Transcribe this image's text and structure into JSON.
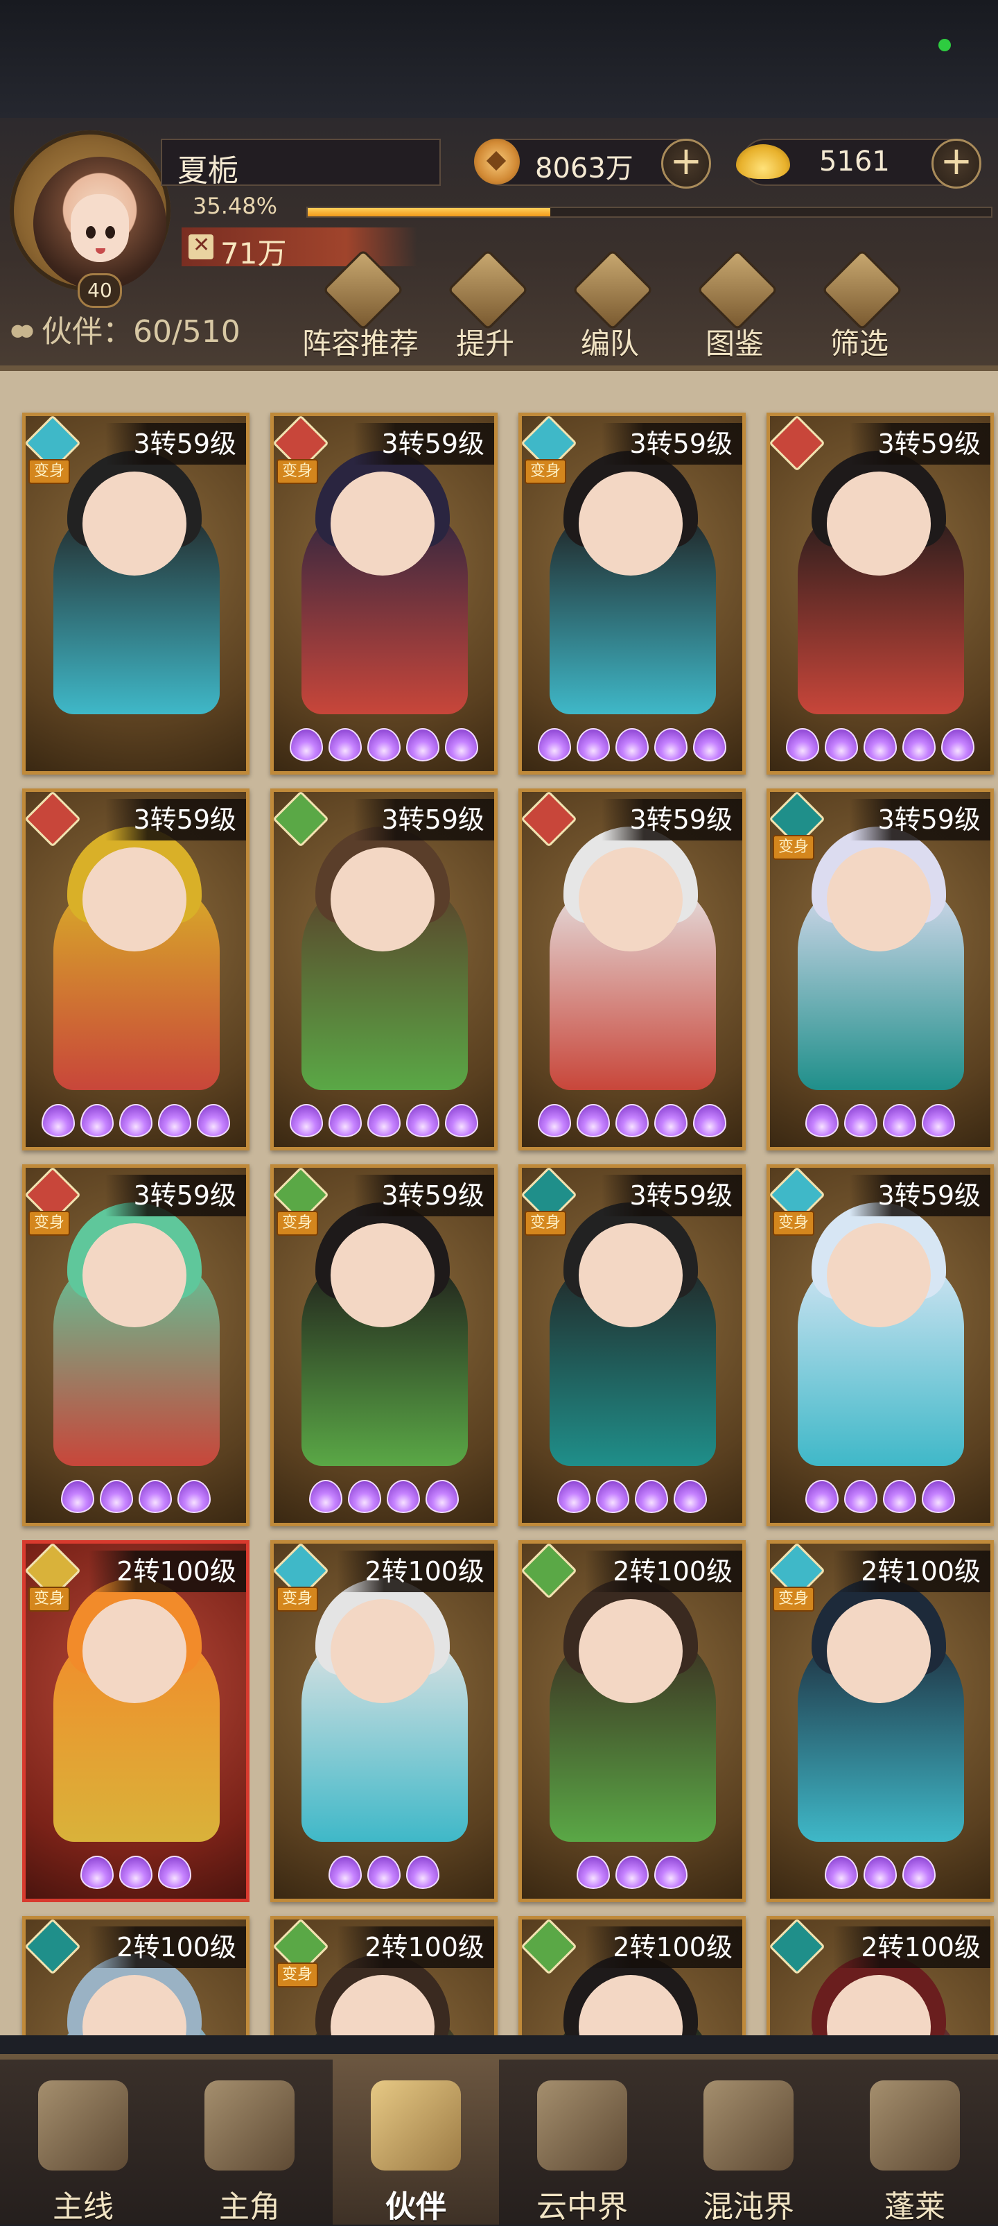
{
  "player": {
    "name": "夏栀",
    "level": "40",
    "coins": "8063万",
    "gold": "5161",
    "exp_percent": "35.48%",
    "exp_fraction": 0.3548,
    "power": "71万"
  },
  "partners": {
    "count_label": "伙伴：60/510"
  },
  "menu": [
    {
      "label": "阵容推荐",
      "icon": "recommend-icon"
    },
    {
      "label": "提升",
      "icon": "upgrade-icon"
    },
    {
      "label": "编队",
      "icon": "formation-icon"
    },
    {
      "label": "图鉴",
      "icon": "codex-icon"
    },
    {
      "label": "筛选",
      "icon": "filter-icon"
    }
  ],
  "transform_label": "变身",
  "cards": [
    {
      "level": "3转59级",
      "element": "water",
      "transform": true,
      "stars": 0,
      "theme": "brown",
      "hair": "#222"
    },
    {
      "level": "3转59级",
      "element": "fire",
      "transform": true,
      "stars": 5,
      "theme": "brown",
      "hair": "#2a2540"
    },
    {
      "level": "3转59级",
      "element": "water",
      "transform": true,
      "stars": 5,
      "theme": "brown",
      "hair": "#1e1a1a"
    },
    {
      "level": "3转59级",
      "element": "fire",
      "transform": false,
      "stars": 5,
      "theme": "brown",
      "hair": "#1e1a1a"
    },
    {
      "level": "3转59级",
      "element": "fire",
      "transform": false,
      "stars": 5,
      "theme": "brown",
      "hair": "#d9b028"
    },
    {
      "level": "3转59级",
      "element": "wood",
      "transform": false,
      "stars": 5,
      "theme": "brown",
      "hair": "#5a3e2a"
    },
    {
      "level": "3转59级",
      "element": "fire",
      "transform": false,
      "stars": 5,
      "theme": "brown",
      "hair": "#e6e6e6"
    },
    {
      "level": "3转59级",
      "element": "ghost",
      "transform": true,
      "stars": 4,
      "theme": "brown",
      "hair": "#dcdcf0"
    },
    {
      "level": "3转59级",
      "element": "fire",
      "transform": true,
      "stars": 4,
      "theme": "brown",
      "hair": "#5fc79b"
    },
    {
      "level": "3转59级",
      "element": "wood",
      "transform": true,
      "stars": 4,
      "theme": "brown",
      "hair": "#1e1a1a"
    },
    {
      "level": "3转59级",
      "element": "ghost",
      "transform": true,
      "stars": 4,
      "theme": "brown",
      "hair": "#222"
    },
    {
      "level": "3转59级",
      "element": "water",
      "transform": true,
      "stars": 4,
      "theme": "brown",
      "hair": "#d7e6f4"
    },
    {
      "level": "2转100级",
      "element": "gold",
      "transform": true,
      "stars": 3,
      "theme": "red",
      "hair": "#f28b2a"
    },
    {
      "level": "2转100级",
      "element": "water",
      "transform": true,
      "stars": 3,
      "theme": "brown",
      "hair": "#e4e4e4"
    },
    {
      "level": "2转100级",
      "element": "wood",
      "transform": false,
      "stars": 3,
      "theme": "brown",
      "hair": "#3a2a20"
    },
    {
      "level": "2转100级",
      "element": "water",
      "transform": true,
      "stars": 3,
      "theme": "brown",
      "hair": "#1d2a3a"
    },
    {
      "level": "2转100级",
      "element": "ghost",
      "transform": false,
      "stars": 0,
      "theme": "brown",
      "hair": "#9ab2c4"
    },
    {
      "level": "2转100级",
      "element": "wood",
      "transform": true,
      "stars": 0,
      "theme": "brown",
      "hair": "#3a2a20"
    },
    {
      "level": "2转100级",
      "element": "wood",
      "transform": false,
      "stars": 0,
      "theme": "brown",
      "hair": "#1e1a1a"
    },
    {
      "level": "2转100级",
      "element": "ghost",
      "transform": false,
      "stars": 0,
      "theme": "brown",
      "hair": "#6a1e1e"
    }
  ],
  "element_colors": {
    "water": "#3fb8c8",
    "fire": "#c8463a",
    "wood": "#5aa846",
    "ghost": "#1f8f8a",
    "gold": "#d9b23a"
  },
  "nav": [
    {
      "label": "主线",
      "icon": "main-quest-icon",
      "active": false
    },
    {
      "label": "主角",
      "icon": "hero-icon",
      "active": false
    },
    {
      "label": "伙伴",
      "icon": "partner-icon",
      "active": true
    },
    {
      "label": "云中界",
      "icon": "cloud-realm-icon",
      "active": false
    },
    {
      "label": "混沌界",
      "icon": "chaos-realm-icon",
      "active": false
    },
    {
      "label": "蓬莱",
      "icon": "penglai-icon",
      "active": false
    }
  ]
}
